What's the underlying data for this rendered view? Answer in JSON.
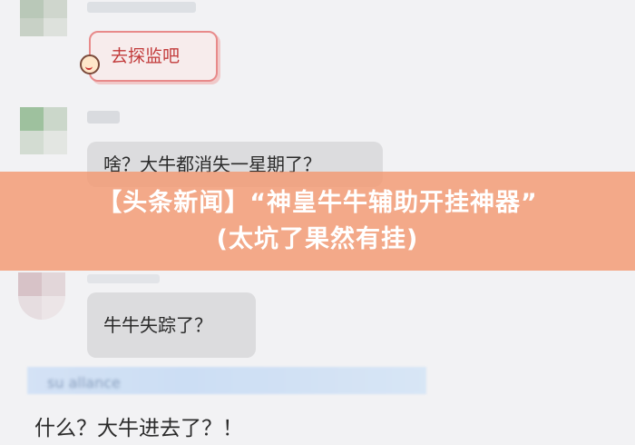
{
  "chat": {
    "messages": [
      {
        "text": "去探监吧"
      },
      {
        "text": "啥？大牛都消失一星期了？"
      },
      {
        "text": "牛牛失踪了？"
      }
    ],
    "input_text": "什么？大牛进去了？！",
    "blurred_strip_text": "su allance"
  },
  "banner": {
    "line1": "【头条新闻】“神皇牛牛辅助开挂神器”",
    "line2": "(太坑了果然有挂)"
  },
  "colors": {
    "banner_bg": "#f39971",
    "sticker_border": "#e88a8a",
    "sticker_text": "#c23b3b",
    "bubble_bg": "#dcdcde",
    "page_bg": "#f2f2f4"
  }
}
